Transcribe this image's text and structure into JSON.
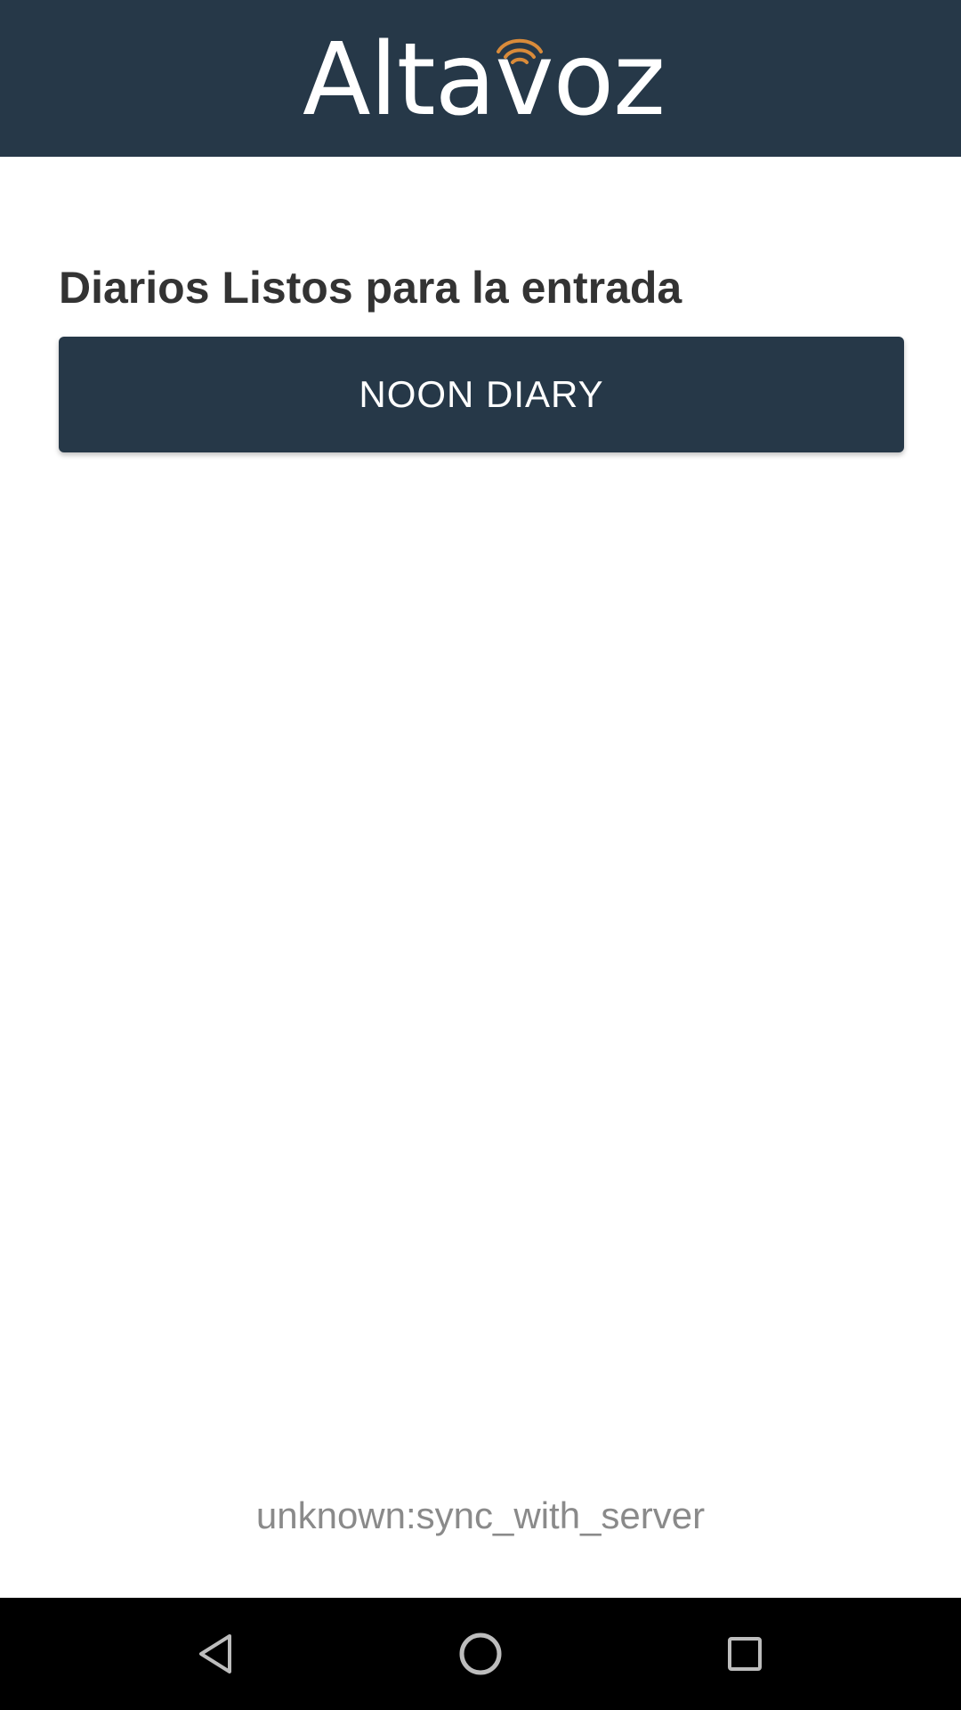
{
  "header": {
    "logo_text": "Altavoz",
    "background_color": "#263848",
    "accent_color": "#D98B3A"
  },
  "main": {
    "section_title": "Diarios Listos para la entrada",
    "diaries": [
      {
        "label": "NOON DIARY"
      }
    ]
  },
  "footer": {
    "status_text": "unknown:sync_with_server"
  },
  "navigation_bar": {
    "back_icon": "back-triangle-icon",
    "home_icon": "home-circle-icon",
    "recents_icon": "recents-square-icon"
  }
}
